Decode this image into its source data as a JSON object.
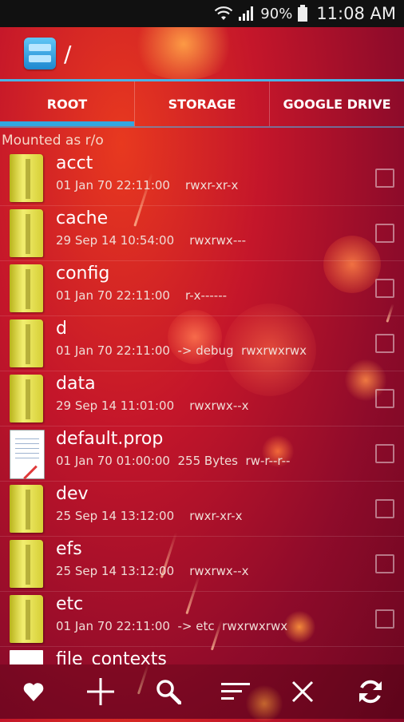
{
  "status": {
    "battery": "90%",
    "time": "11:08 AM"
  },
  "appbar": {
    "path": "/"
  },
  "tabs": [
    {
      "label": "ROOT",
      "active": true
    },
    {
      "label": "STORAGE",
      "active": false
    },
    {
      "label": "GOOGLE DRIVE",
      "active": false
    }
  ],
  "mount_status": "Mounted as r/o",
  "files": [
    {
      "name": "acct",
      "meta": "01 Jan 70 22:11:00    rwxr-xr-x",
      "icon": "folder-icon"
    },
    {
      "name": "cache",
      "meta": "29 Sep 14 10:54:00    rwxrwx---",
      "icon": "folder-icon"
    },
    {
      "name": "config",
      "meta": "01 Jan 70 22:11:00    r-x------",
      "icon": "folder-icon"
    },
    {
      "name": "d",
      "meta": "01 Jan 70 22:11:00  -> debug  rwxrwxrwx",
      "icon": "folder-icon"
    },
    {
      "name": "data",
      "meta": "29 Sep 14 11:01:00    rwxrwx--x",
      "icon": "folder-icon"
    },
    {
      "name": "default.prop",
      "meta": "01 Jan 70 01:00:00  255 Bytes  rw-r--r--",
      "icon": "text-file-icon"
    },
    {
      "name": "dev",
      "meta": "25 Sep 14 13:12:00    rwxr-xr-x",
      "icon": "folder-icon"
    },
    {
      "name": "efs",
      "meta": "25 Sep 14 13:12:00    rwxrwx--x",
      "icon": "folder-icon"
    },
    {
      "name": "etc",
      "meta": "01 Jan 70 22:11:00  -> etc  rwxrwxrwx",
      "icon": "folder-icon"
    },
    {
      "name": "file_contexts",
      "meta": "",
      "icon": "file-icon"
    }
  ],
  "bottom_actions": [
    "favorites-heart-icon",
    "add-plus-icon",
    "search-icon",
    "sort-icon",
    "close-x-icon",
    "refresh-icon"
  ],
  "colors": {
    "accent": "#33a7e0",
    "folder": "#e6df4a"
  }
}
